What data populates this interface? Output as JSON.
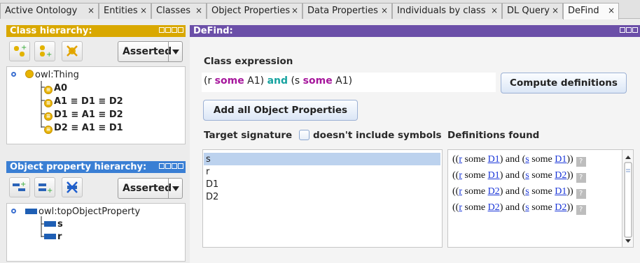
{
  "tabs": [
    {
      "label": "Active Ontology"
    },
    {
      "label": "Entities"
    },
    {
      "label": "Classes"
    },
    {
      "label": "Object Properties"
    },
    {
      "label": "Data Properties"
    },
    {
      "label": "Individuals by class"
    },
    {
      "label": "DL Query"
    },
    {
      "label": "DeFind"
    }
  ],
  "tab_close": "×",
  "class_hierarchy": {
    "title": "Class hierarchy:",
    "mode": "Asserted",
    "root": "owl:Thing",
    "items": [
      {
        "label": "A0"
      },
      {
        "label": "A1 ≡ D1 ≡ D2"
      },
      {
        "label": "D1 ≡ A1 ≡ D2"
      },
      {
        "label": "D2 ≡ A1 ≡ D1"
      }
    ]
  },
  "object_property_hierarchy": {
    "title": "Object property hierarchy:",
    "mode": "Asserted",
    "root": "owl:topObjectProperty",
    "items": [
      {
        "label": "s"
      },
      {
        "label": "r"
      }
    ]
  },
  "defind": {
    "title": "DeFind:",
    "class_expression_label": "Class expression",
    "expression_parts": [
      "(r ",
      "some",
      " A1) ",
      "and",
      " (s ",
      "some",
      " A1)"
    ],
    "compute_button": "Compute definitions",
    "add_all_button": "Add all Object Properties",
    "target_signature_label": "Target signature",
    "checkbox_label": "doesn't include symbols",
    "checkbox_checked": false,
    "definitions_label": "Definitions found",
    "signature": [
      "s",
      "r",
      "D1",
      "D2"
    ],
    "selected_signature": "s",
    "definitions": [
      [
        "((",
        "r",
        " some ",
        "D1",
        ") and (",
        "s",
        " some ",
        "D1",
        "))"
      ],
      [
        "((",
        "r",
        " some ",
        "D1",
        ") and (",
        "s",
        " some ",
        "D2",
        "))"
      ],
      [
        "((",
        "r",
        " some ",
        "D2",
        ") and (",
        "s",
        " some ",
        "D1",
        "))"
      ],
      [
        "((",
        "r",
        " some ",
        "D2",
        ") and (",
        "s",
        " some ",
        "D2",
        "))"
      ]
    ],
    "help_mark": "?"
  },
  "colors": {
    "class_header": "#d9a800",
    "defind_header": "#6b4fa8",
    "prop_header": "#3a7fd4",
    "keyword": "#a6169c",
    "and_keyword": "#17a3a0"
  },
  "icons": [
    "add-subclass-icon",
    "add-sibling-class-icon",
    "delete-class-icon",
    "add-sub-property-icon",
    "add-sibling-property-icon",
    "delete-property-icon",
    "question-icon"
  ]
}
